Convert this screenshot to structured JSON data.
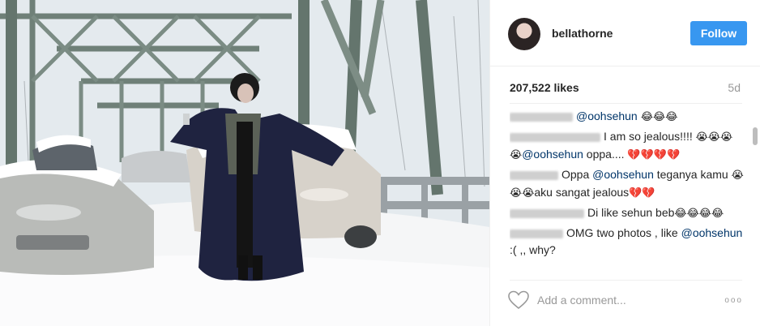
{
  "post": {
    "username": "bellathorne",
    "follow_label": "Follow",
    "likes": "207,522 likes",
    "age": "5d",
    "comments": [
      {
        "handle_width": 78,
        "parts": [
          {
            "t": "@oohsehun",
            "k": "mention"
          },
          {
            "t": " 😂😂😂",
            "k": "emoji"
          }
        ]
      },
      {
        "handle_width": 112,
        "parts": [
          {
            "t": "I am so jealous!!!! ",
            "k": "text"
          },
          {
            "t": "😭😭😭😭",
            "k": "emoji"
          },
          {
            "t": "@oohsehun",
            "k": "mention"
          },
          {
            "t": " oppa.... ",
            "k": "text"
          },
          {
            "t": "💔💔💔💔",
            "k": "emoji"
          }
        ]
      },
      {
        "handle_width": 60,
        "parts": [
          {
            "t": "Oppa ",
            "k": "text"
          },
          {
            "t": "@oohsehun",
            "k": "mention"
          },
          {
            "t": " teganya kamu ",
            "k": "text"
          },
          {
            "t": "😭😭😭",
            "k": "emoji"
          },
          {
            "t": "aku sangat jealous",
            "k": "text"
          },
          {
            "t": "💔💔",
            "k": "emoji"
          }
        ]
      },
      {
        "handle_width": 92,
        "parts": [
          {
            "t": "Di like sehun beb",
            "k": "text"
          },
          {
            "t": "😂😂😂😂",
            "k": "emoji"
          }
        ]
      },
      {
        "handle_width": 66,
        "parts": [
          {
            "t": "OMG two photos , like ",
            "k": "text"
          },
          {
            "t": "@oohsehun",
            "k": "mention"
          },
          {
            "t": " :( ,, why?",
            "k": "text"
          }
        ]
      }
    ],
    "comment_placeholder": "Add a comment...",
    "more_label": "ooo"
  },
  "icons": {
    "heart": "heart-outline-icon",
    "more": "more-options-icon"
  },
  "colors": {
    "follow_button": "#3897f0",
    "mention": "#003569",
    "muted": "#999999"
  }
}
